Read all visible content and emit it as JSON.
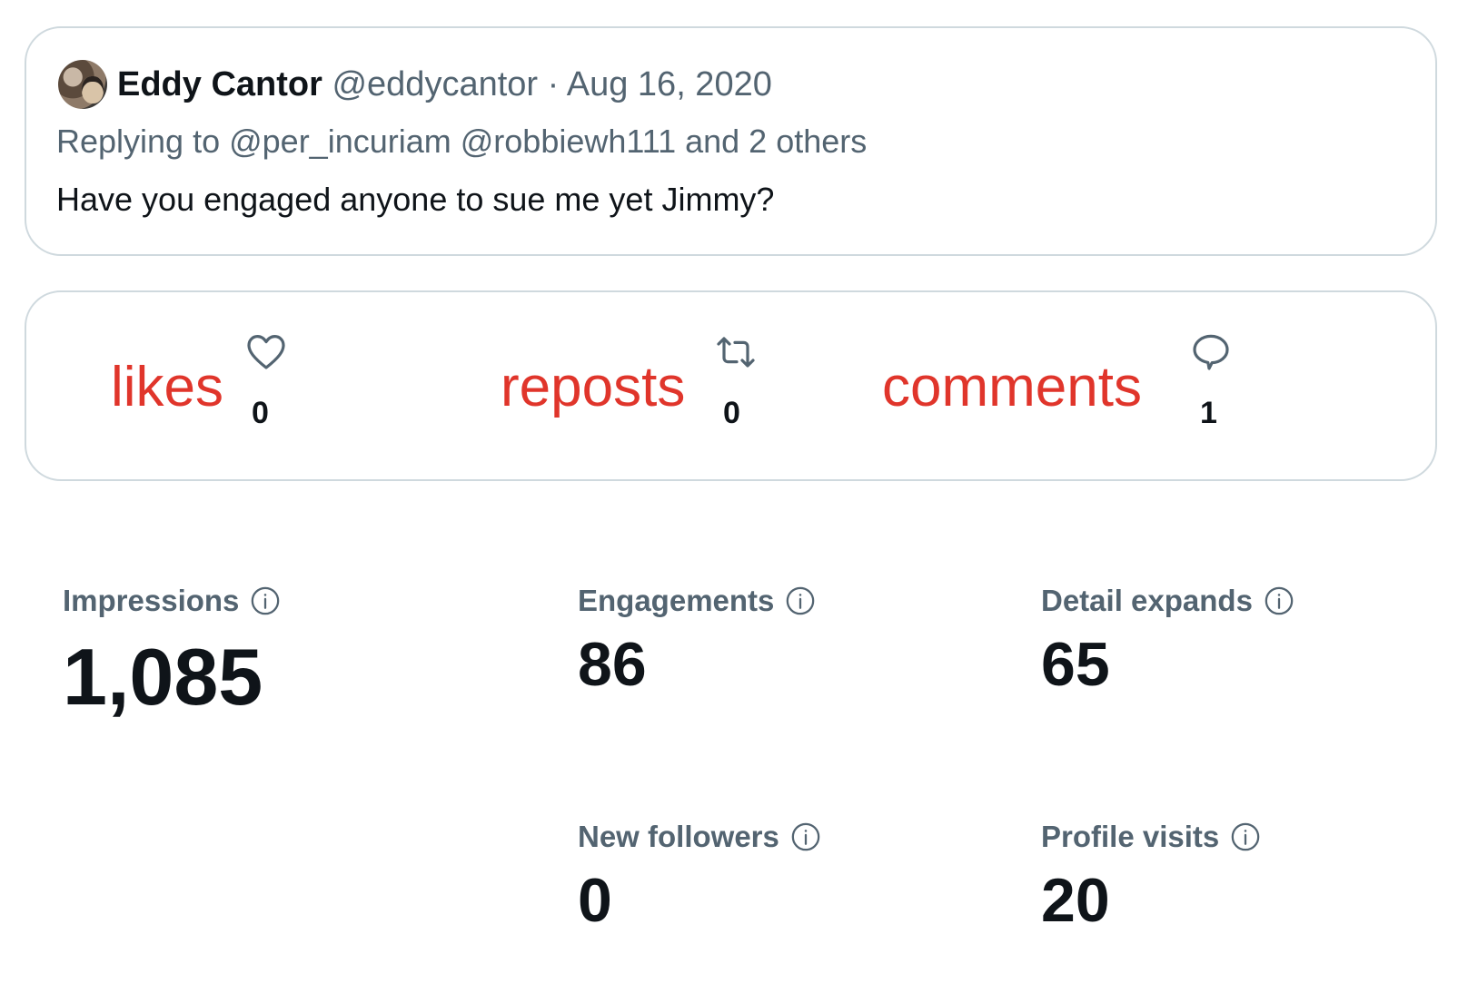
{
  "tweet": {
    "author_name": "Eddy Cantor",
    "author_handle": "@eddycantor",
    "separator": "·",
    "date": "Aug 16, 2020",
    "reply_line": "Replying to @per_incuriam @robbiewh111 and 2 others",
    "text": "Have you engaged anyone to sue me yet Jimmy?"
  },
  "reactions": {
    "likes": {
      "label": "likes",
      "count": "0",
      "icon": "heart-icon"
    },
    "reposts": {
      "label": "reposts",
      "count": "0",
      "icon": "retweet-icon"
    },
    "comments": {
      "label": "comments",
      "count": "1",
      "icon": "reply-icon"
    }
  },
  "metrics": {
    "impressions": {
      "label": "Impressions",
      "value": "1,085",
      "icon": "info-icon"
    },
    "engagements": {
      "label": "Engagements",
      "value": "86",
      "icon": "info-icon"
    },
    "detail_expands": {
      "label": "Detail expands",
      "value": "65",
      "icon": "info-icon"
    },
    "new_followers": {
      "label": "New followers",
      "value": "0",
      "icon": "info-icon"
    },
    "profile_visits": {
      "label": "Profile visits",
      "value": "20",
      "icon": "info-icon"
    }
  },
  "colors": {
    "label_red": "#e0352b",
    "secondary_text": "#536471",
    "primary_text": "#0f1419",
    "border": "#cfd9de"
  }
}
